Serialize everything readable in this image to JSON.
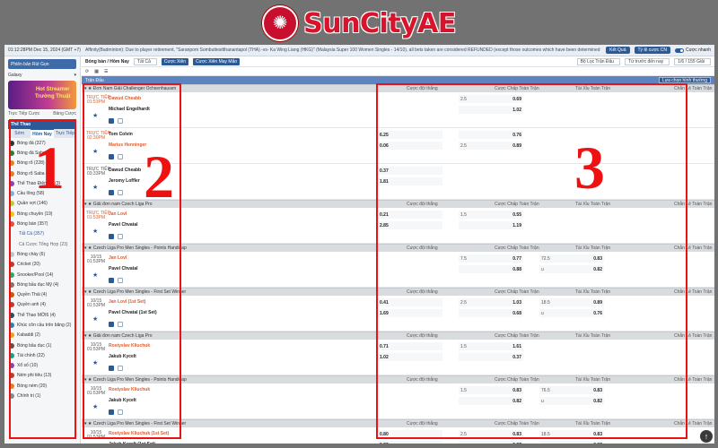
{
  "brand": {
    "name": "SunCityAE",
    "emblem": "sun-wheel-icon",
    "color": "#d7142b"
  },
  "topbar": {
    "time": "01:12:28PM Dec 15, 2024 (GMT +7)",
    "ticker": "Affinity(Badminton): Due to player retirement, \"Saranpom Sombuttesitthanantapol (THA) -vs- Ka Wing Liang (HKG)\" (Malaysia Super 100 Women Singles - 14/10), all bets taken are considered REFUNDED (except those outcomes which have been determined the",
    "btn_result": "Kết Quả",
    "btn_bettype": "Tỷ lệ cược CN",
    "toggle_label": "Cược nhanh"
  },
  "sidebar": {
    "balance_label": "Phiên bản Rút Gọn",
    "bet_label": "Galaxy",
    "banner_text": "Hot Streamer\nTrường Thuật",
    "link_left": "Trực Tiếp Cược ",
    "link_right": "Bảng Cược",
    "sports_header": "Thể Thao",
    "tabs": [
      "Sớm",
      "Hôm Nay",
      "Trực Tiếp"
    ],
    "items": [
      {
        "label": "Bóng đá (327)",
        "color": "#333"
      },
      {
        "label": "Bóng đá Saba (2)",
        "color": "#2e7d32"
      },
      {
        "label": "Bóng rổ (228)",
        "color": "#e67e22"
      },
      {
        "label": "Bóng rổ Saba (4)",
        "color": "#e67e22"
      },
      {
        "label": "Thể Thao Điện Tử (3)",
        "color": "#8e44ad"
      },
      {
        "label": "Cầu lông (58)",
        "color": "#7fb3d5"
      },
      {
        "label": "Quần vợt (146)",
        "color": "#c0ca33"
      },
      {
        "label": "Bóng chuyền (19)",
        "color": "#f1c40f"
      },
      {
        "label": "Bóng bàn (357)",
        "color": "#e74c3c"
      },
      {
        "label": "Tất Cả (357)",
        "color": "",
        "sub": true,
        "cur": true
      },
      {
        "label": "Cá Cược Tổng Hợp (23)",
        "color": "",
        "sub": true
      },
      {
        "label": "Bóng chày (6)",
        "color": "#bdc3c7"
      },
      {
        "label": "Cricket (20)",
        "color": "#c0392b"
      },
      {
        "label": "Snooker/Pool (14)",
        "color": "#27ae60"
      },
      {
        "label": "Bóng bầu dục Mỹ (4)",
        "color": "#8d6e63"
      },
      {
        "label": "Quyền Thái (4)",
        "color": "#d35400"
      },
      {
        "label": "Quyền anh (4)",
        "color": "#c0392b"
      },
      {
        "label": "Thể Thao MỚI6 (4)",
        "color": "#34495e"
      },
      {
        "label": "Khúc côn cầu trên băng (2)",
        "color": "#2980b9"
      },
      {
        "label": "Kabaddi (2)",
        "color": "#f39c12"
      },
      {
        "label": "Bóng bầu dục (1)",
        "color": "#6d4c41"
      },
      {
        "label": "Tài chính (22)",
        "color": "#16a085"
      },
      {
        "label": "Xổ số (10)",
        "color": "#8e44ad"
      },
      {
        "label": "Ném phi tiêu (13)",
        "color": "#c0392b"
      },
      {
        "label": "Bóng ném (20)",
        "color": "#e67e22"
      },
      {
        "label": "Chính trị (1)",
        "color": "#7f8c8d"
      }
    ]
  },
  "main": {
    "title": "Bóng bàn / Hôm Nay",
    "sel_all": "Tất Cả",
    "btn_odds": "Cược Xiên",
    "btn_parlay": "Cược Xiên May Mắn",
    "sel_filter": "Bộ Lọc Trận Đấu",
    "sel_sort": "Từ trước đến nay",
    "pager": "1/6 / 155 Giải",
    "tab": "Trận Đấu",
    "sel_view": "Lựa chọn hình thường",
    "columns": [
      "Cược đội thắng",
      "Cược Chấp Toàn Trận",
      "Tài Xỉu Toàn Trận",
      "Chẵn Lẻ Toàn Trận"
    ]
  },
  "leagues": [
    {
      "name": "Đơn Nam Giải Challenger Ochsenhausen",
      "headers": true,
      "matches": [
        {
          "time": "TRỰC TIẾP\n01:53PM",
          "live": true,
          "home": "Dawud Cheabb",
          "away": "Michael Engelhardt",
          "fav": "home",
          "win": [
            "",
            ""
          ],
          "hdp": [
            "2.5",
            "0.69",
            "",
            "1.02"
          ],
          "ou": [
            "",
            "",
            "",
            ""
          ]
        },
        {
          "time": "TRỰC TIẾP\n02:30PM",
          "live": true,
          "home": "Tom Colvin",
          "away": "Marius Henninger",
          "fav": "away",
          "win": [
            "6.25",
            "0.06"
          ],
          "hdp": [
            "",
            "0.76",
            "2.5",
            "0.89"
          ],
          "ou": [
            "",
            "",
            "",
            ""
          ]
        },
        {
          "time": "TRỰC TIẾP\n03:33PM",
          "live": false,
          "home": "Dawud Cheabb",
          "away": "Jeromy Loffler",
          "fav": "",
          "win": [
            "0.37",
            "1.81"
          ],
          "hdp": [
            "",
            "",
            "",
            ""
          ],
          "ou": [
            "",
            "",
            "",
            ""
          ]
        }
      ]
    },
    {
      "name": "Giải đơn nam Czech Liga Pro",
      "headers": true,
      "matches": [
        {
          "time": "TRỰC TIẾP\n01:53PM",
          "live": true,
          "home": "Jan Lovl",
          "away": "Pavel Chvatal",
          "fav": "home",
          "win": [
            "0.21",
            "2.85"
          ],
          "hdp": [
            "1.5",
            "0.55",
            "",
            "1.19"
          ],
          "ou": [
            "",
            "",
            "",
            ""
          ]
        }
      ]
    },
    {
      "name": "Czech Liga Pro Men Singles - Points Handicap",
      "headers": true,
      "matches": [
        {
          "time": "10/15\n01:53PM",
          "live": false,
          "home": "Jan Lovl",
          "away": "Pavel Chvatal",
          "fav": "home",
          "win": [
            "",
            ""
          ],
          "hdp": [
            "7.5",
            "0.77",
            "",
            "0.88"
          ],
          "ou": [
            "72.5",
            "0.83",
            "u",
            "0.82"
          ]
        }
      ]
    },
    {
      "name": "Czech Liga Pro Men Singles - First Set Winner",
      "headers": true,
      "matches": [
        {
          "time": "10/15\n01:53PM",
          "live": false,
          "home": "Jan Lovl (1st Set)",
          "away": "Pavel Chvatal (1st Set)",
          "fav": "home",
          "win": [
            "0.41",
            "1.69"
          ],
          "hdp": [
            "2.5",
            "1.03",
            "",
            "0.68"
          ],
          "ou": [
            "18.5",
            "0.89",
            "u",
            "0.76"
          ]
        }
      ]
    },
    {
      "name": "Giải đơn nam Czech Liga Pro",
      "headers": true,
      "matches": [
        {
          "time": "10/15\n01:53PM",
          "live": false,
          "home": "Rostyslav Kliuchuk",
          "away": "Jakub Kycelt",
          "fav": "home",
          "win": [
            "0.71",
            "1.02"
          ],
          "hdp": [
            "1.5",
            "1.61",
            "",
            "0.37"
          ],
          "ou": [
            "",
            "",
            "",
            ""
          ]
        }
      ]
    },
    {
      "name": "Czech Liga Pro Men Singles - Points Handicap",
      "headers": true,
      "matches": [
        {
          "time": "10/15\n01:53PM",
          "live": false,
          "home": "Rostyslav Kliuchuk",
          "away": "Jakub Kycelt",
          "fav": "home",
          "win": [
            "",
            ""
          ],
          "hdp": [
            "1.5",
            "0.83",
            "",
            "0.82"
          ],
          "ou": [
            "76.5",
            "0.83",
            "u",
            "0.82"
          ]
        }
      ]
    },
    {
      "name": "Czech Liga Pro Men Singles - First Set Winner",
      "headers": true,
      "matches": [
        {
          "time": "10/15\n01:53PM",
          "live": false,
          "home": "Rostyslav Kliuchuk (1st Set)",
          "away": "Jakub Kycelt (1st Set)",
          "fav": "home",
          "win": [
            "0.80",
            "0.92"
          ],
          "hdp": [
            "2.5",
            "0.83",
            "",
            "0.37"
          ],
          "ou": [
            "18.5",
            "0.83",
            "u",
            "0.82"
          ]
        }
      ]
    }
  ],
  "callouts": [
    {
      "label": "1",
      "color": "#e11"
    },
    {
      "label": "2",
      "color": "#e11"
    },
    {
      "label": "3",
      "color": "#e11"
    }
  ],
  "colors": {
    "accent": "#2c5a96",
    "live": "#e25b2b",
    "annotation": "#e11"
  }
}
